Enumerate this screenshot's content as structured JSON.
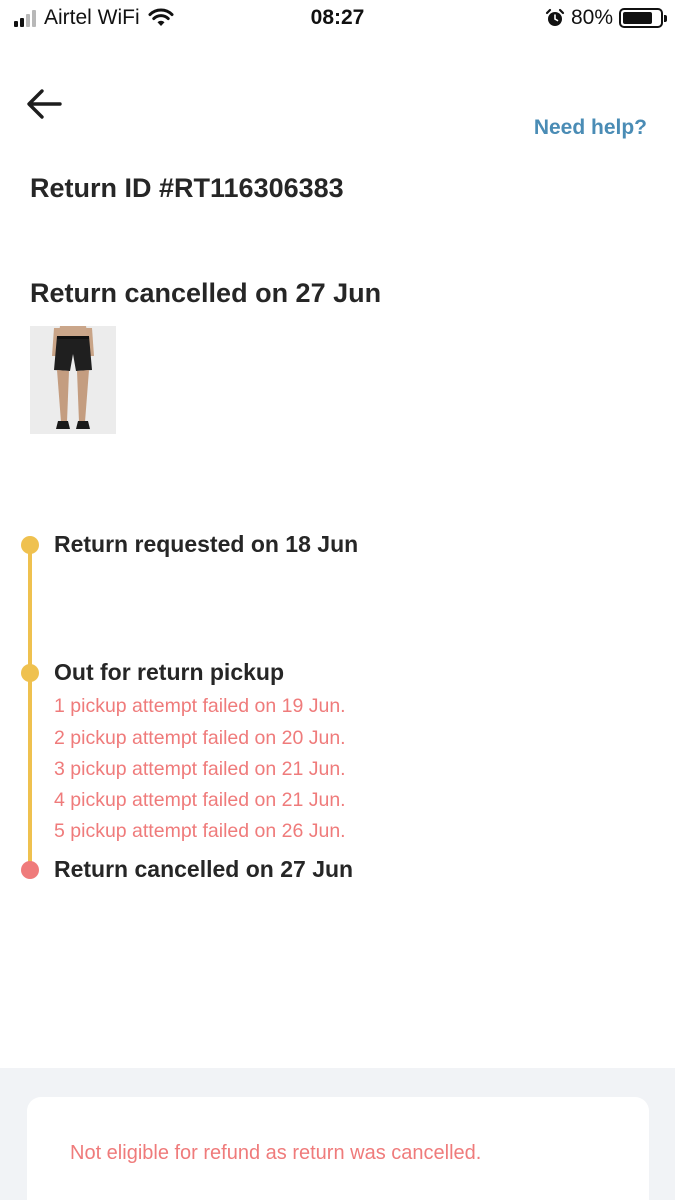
{
  "status_bar": {
    "carrier": "Airtel WiFi",
    "time": "08:27",
    "battery_percent": "80%",
    "battery_level": 0.8
  },
  "header": {
    "back_icon": "arrow-left-icon",
    "help_label": "Need help?"
  },
  "return": {
    "id_label": "Return ID #RT116306383",
    "status_title": "Return cancelled on 27 Jun",
    "product_image": "black-shorts-product-photo"
  },
  "timeline": {
    "steps": [
      {
        "title": "Return requested on 18 Jun",
        "state": "done"
      },
      {
        "title": "Out for return pickup",
        "state": "done",
        "notes": [
          "1 pickup attempt failed on 19 Jun.",
          "2 pickup attempt failed on 20 Jun.",
          "3 pickup attempt failed on 21 Jun.",
          "4 pickup attempt failed on 21 Jun.",
          "5 pickup attempt failed on 26 Jun."
        ]
      },
      {
        "title": "Return cancelled on 27 Jun",
        "state": "cancelled"
      }
    ]
  },
  "refund": {
    "message": "Not eligible for refund as return was cancelled."
  },
  "colors": {
    "accent_link": "#4a8cb5",
    "timeline_progress": "#efc14f",
    "error": "#ef7b7b"
  }
}
